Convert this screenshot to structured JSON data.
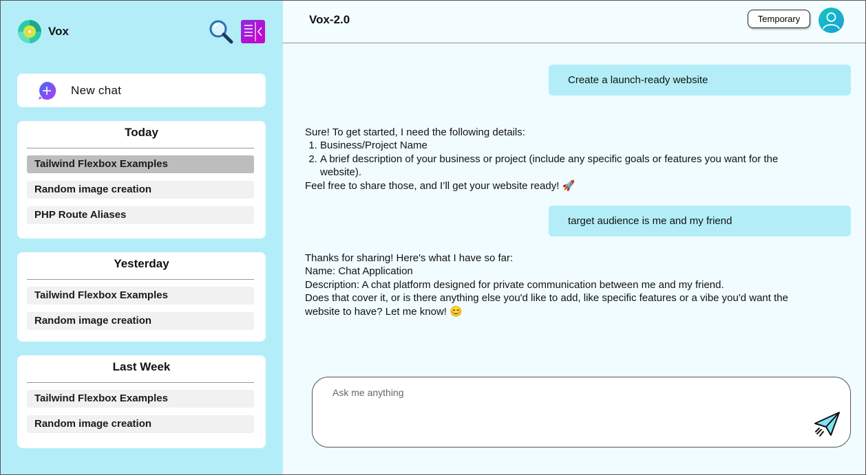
{
  "brand": {
    "name": "Vox",
    "logo_icon": "vox-disc-logo-icon"
  },
  "sidebar": {
    "search_icon": "search-icon",
    "panel_icon": "collapse-sidebar-icon",
    "new_chat_label": "New chat",
    "groups": [
      {
        "title": "Today",
        "items": [
          "Tailwind Flexbox Examples",
          "Random image creation",
          "PHP Route Aliases"
        ],
        "active_index": 0
      },
      {
        "title": "Yesterday",
        "items": [
          "Tailwind Flexbox Examples",
          "Random image creation"
        ]
      },
      {
        "title": "Last Week",
        "items": [
          "Tailwind Flexbox Examples",
          "Random image creation"
        ]
      }
    ]
  },
  "header": {
    "model_name": "Vox-2.0",
    "temporary_label": "Temporary",
    "avatar_icon": "user-avatar-icon"
  },
  "chat": {
    "user_messages": [
      "Create a launch-ready website",
      "target audience is me and my friend"
    ],
    "bot_reply_1": {
      "intro": "Sure! To get started, I need the following details:",
      "list": [
        "Business/Project Name",
        "A brief description of your business or project (include any specific goals or features you want for the website)."
      ],
      "outro": "Feel free to share those, and I’ll get your website ready! 🚀"
    },
    "bot_reply_2": {
      "lines": [
        "Thanks for sharing! Here's what I have so far:",
        "Name: Chat Application",
        "Description: A chat platform designed for private communication between me and my friend.",
        "Does that cover it, or is there anything else you'd like to add, like specific features or a vibe you'd want the website to have? Let me know! 😊"
      ]
    }
  },
  "composer": {
    "placeholder": "Ask me anything",
    "value": "",
    "send_icon": "paper-plane-send-icon"
  },
  "colors": {
    "sidebar_bg": "#b3eef8",
    "main_bg": "#f0fcff",
    "user_bubble": "#b3eef8",
    "accent_cyan": "#29d3e8"
  }
}
